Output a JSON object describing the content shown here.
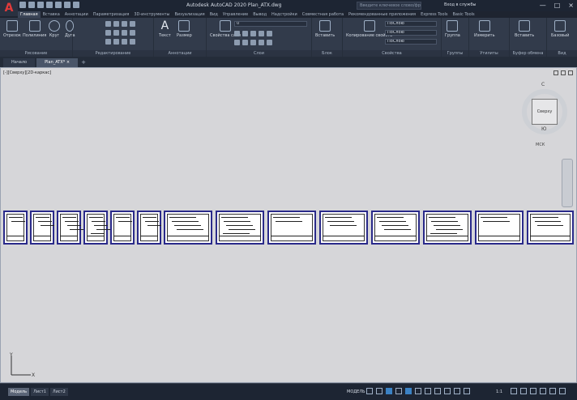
{
  "app": {
    "logo_letter": "A",
    "title": "Autodesk AutoCAD 2020   Plan_ATX.dwg",
    "search_placeholder": "Введите ключевое слово/фразу",
    "user_label": "Вход в службы",
    "window_controls": [
      "—",
      "□",
      "×"
    ]
  },
  "ribbon_tabs": [
    "Главная",
    "Вставка",
    "Аннотации",
    "Параметризация",
    "3D-инструменты",
    "Визуализация",
    "Вид",
    "Управление",
    "Вывод",
    "Надстройки",
    "Совместная работа",
    "Рекомендованные приложения",
    "Express Tools",
    "Basic Tools"
  ],
  "active_ribbon_tab": 0,
  "panels": [
    {
      "label": "Рисование",
      "tools": [
        "Отрезок",
        "Полилиния",
        "Круг",
        "Дуга"
      ]
    },
    {
      "label": "Редактирование",
      "tools": []
    },
    {
      "label": "Аннотации",
      "tools": [
        "Текст",
        "Размер"
      ]
    },
    {
      "label": "Слои",
      "tools": [
        "Свойства слоя"
      ],
      "layer_value": "0"
    },
    {
      "label": "Блок",
      "tools": [
        "Вставить"
      ]
    },
    {
      "label": "Свойства",
      "tools": [
        "Копирование свойств"
      ],
      "props": [
        "ПоСлою",
        "ПоСлою",
        "ПоСлою"
      ]
    },
    {
      "label": "Группы",
      "tools": [
        "Группа"
      ]
    },
    {
      "label": "Утилиты",
      "tools": [
        "Измерить"
      ]
    },
    {
      "label": "Буфер обмена",
      "tools": [
        "Вставить"
      ]
    },
    {
      "label": "Вид",
      "tools": [
        "Базовый"
      ]
    }
  ],
  "doc_tabs": [
    {
      "label": "Начало",
      "active": false
    },
    {
      "label": "Plan_ATX*",
      "active": true,
      "close": "×"
    }
  ],
  "viewport": {
    "label": "[-][Сверху][2D-каркас]",
    "viewcube_face": "Сверху",
    "wcs_label": "МСК",
    "compass_n": "С",
    "compass_s": "Ю"
  },
  "sheets_count": 14,
  "ucs": {
    "x": "X",
    "y": "Y"
  },
  "layout_tabs": [
    {
      "label": "Модель",
      "active": true
    },
    {
      "label": "Лист1",
      "active": false
    },
    {
      "label": "Лист2",
      "active": false
    }
  ],
  "status": {
    "model_label": "МОДЕЛЬ",
    "scale": "1:1"
  },
  "colors": {
    "bg": "#1e2430",
    "ribbon": "#323b4b",
    "canvas": "#d6d6d9",
    "sheet_border": "#2a2a8a",
    "accent": "#3b82c4"
  }
}
